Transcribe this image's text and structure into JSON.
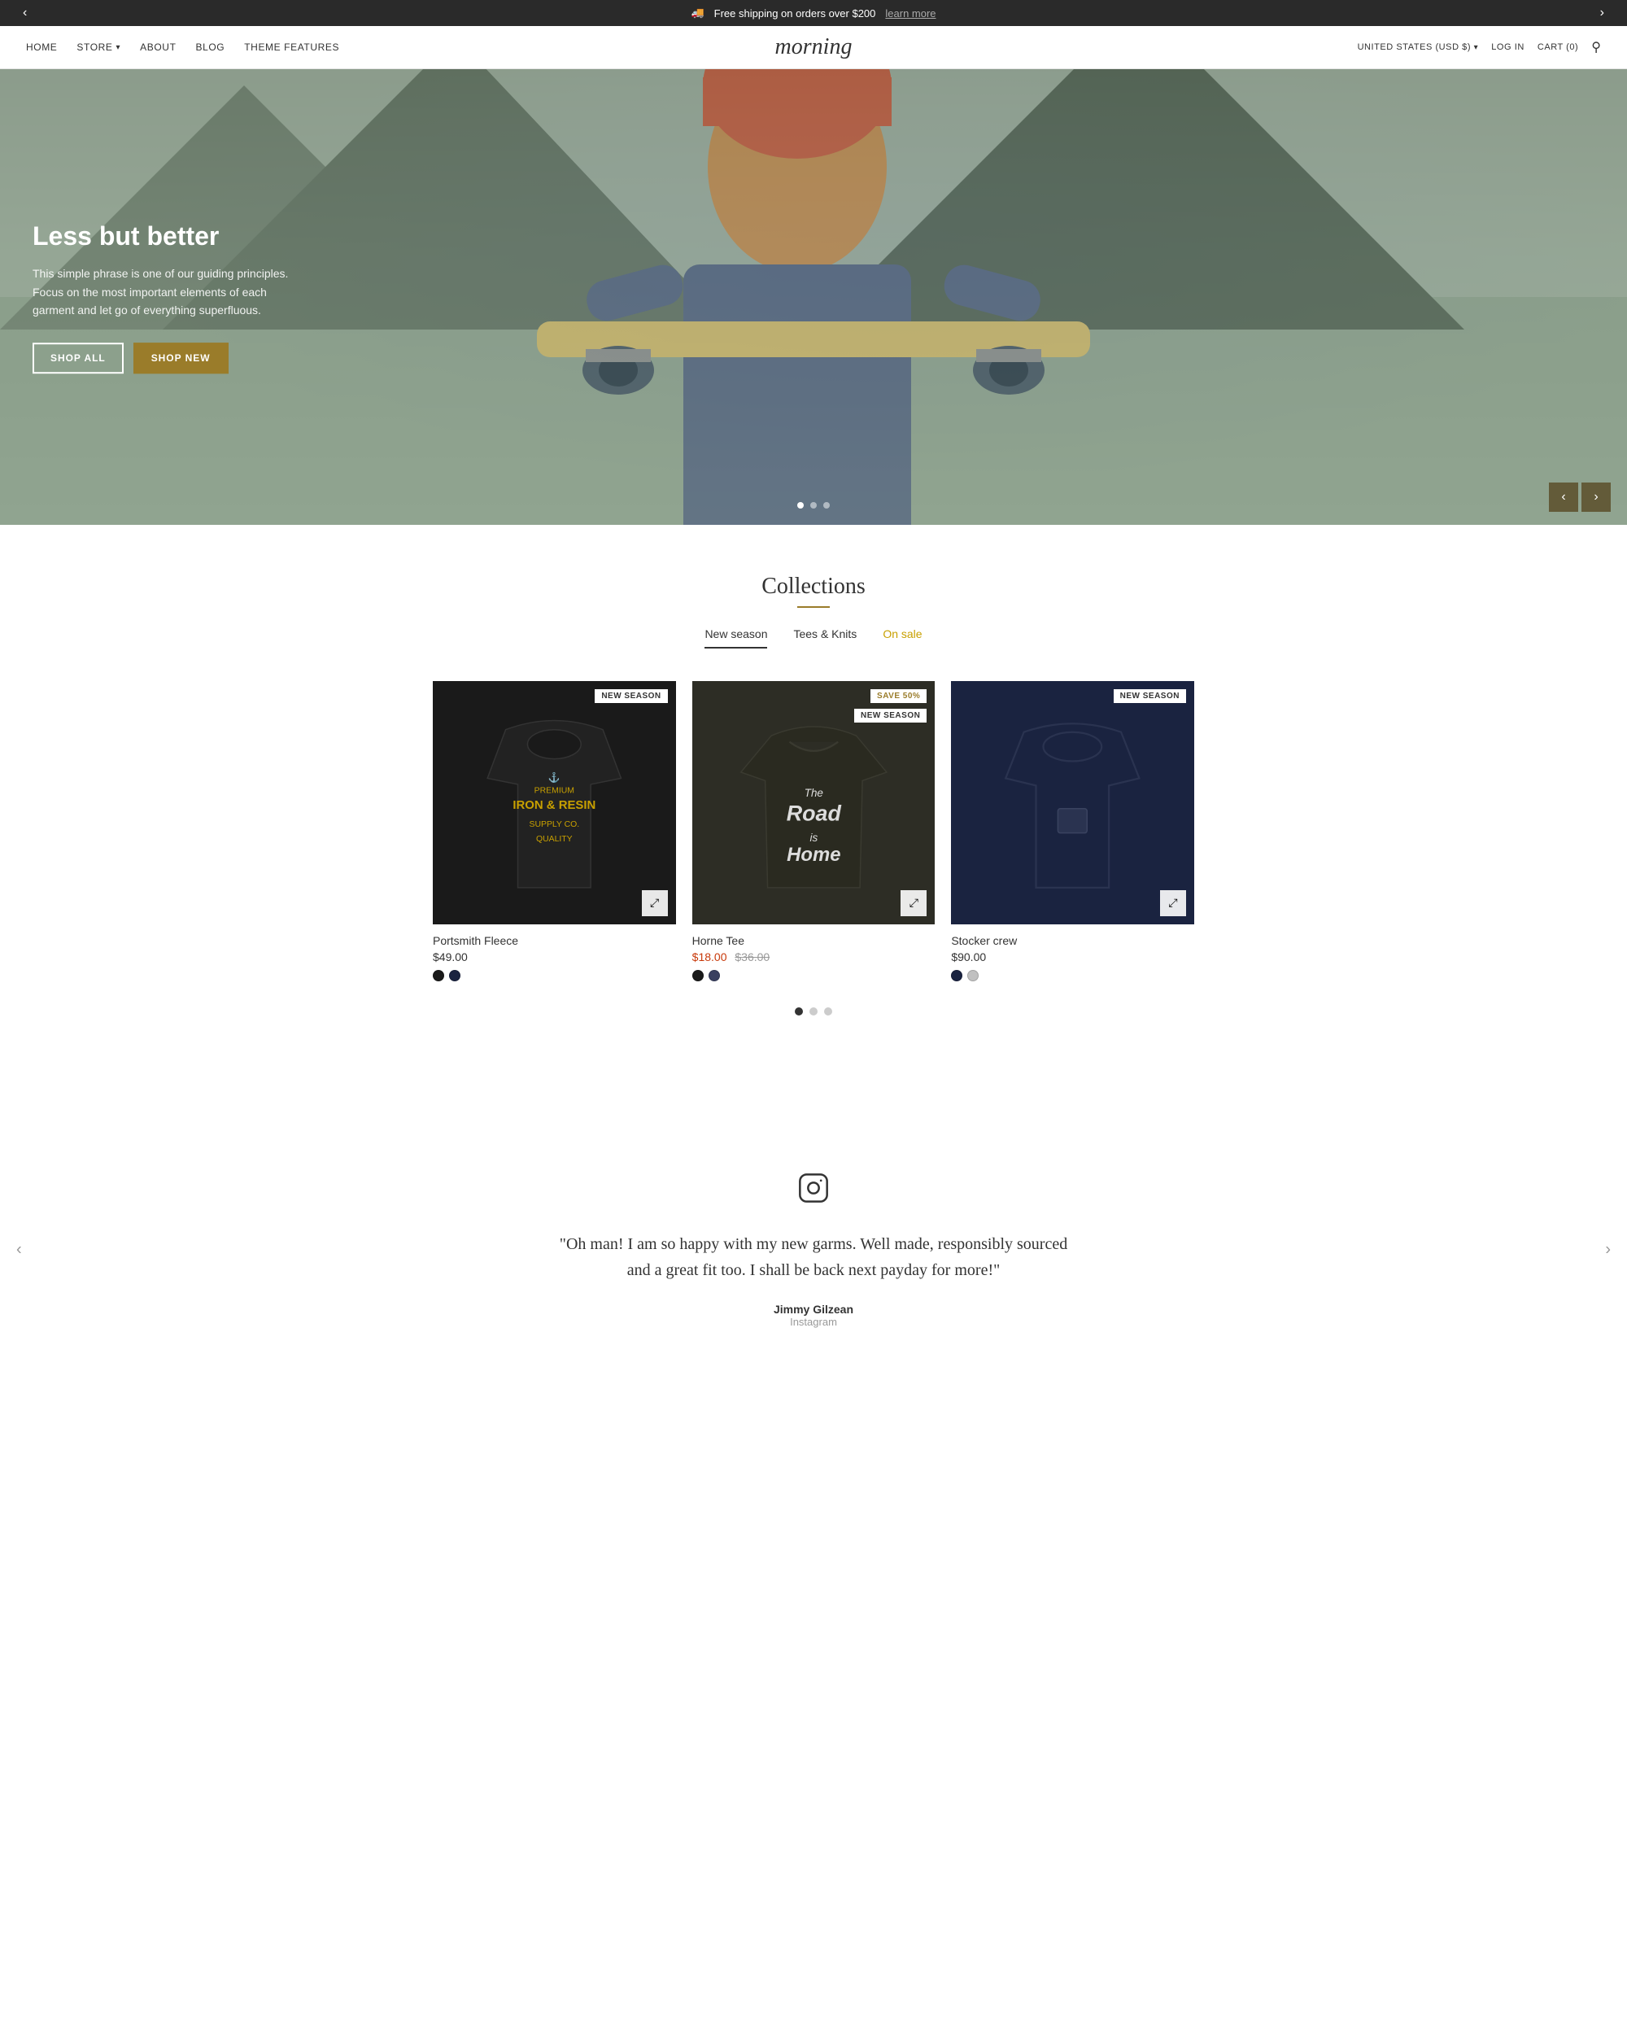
{
  "announcement": {
    "text": "Free shipping on orders over $200",
    "link_text": "learn more",
    "link_url": "#"
  },
  "nav": {
    "left_items": [
      {
        "id": "home",
        "label": "HOME",
        "url": "#"
      },
      {
        "id": "store",
        "label": "STORE",
        "url": "#",
        "has_dropdown": true
      },
      {
        "id": "about",
        "label": "ABOUT",
        "url": "#"
      },
      {
        "id": "blog",
        "label": "BLOG",
        "url": "#"
      },
      {
        "id": "theme-features",
        "label": "THEME FEATURES",
        "url": "#"
      }
    ],
    "logo": "morning",
    "right_items": [
      {
        "id": "region",
        "label": "UNITED STATES (USD $)",
        "url": "#",
        "has_dropdown": true
      },
      {
        "id": "login",
        "label": "LOG IN",
        "url": "#"
      },
      {
        "id": "cart",
        "label": "CART (0)",
        "url": "#"
      }
    ]
  },
  "hero": {
    "title": "Less but better",
    "description": "This simple phrase is one of our guiding principles. Focus on the most important elements of each garment and let go of everything superfluous.",
    "btn_shop_all": "SHOP ALL",
    "btn_shop_new": "SHOP NEW",
    "dots": [
      1,
      2,
      3
    ],
    "active_dot": 1
  },
  "collections": {
    "title": "Collections",
    "tabs": [
      {
        "id": "new-season",
        "label": "New season",
        "active": true,
        "sale": false
      },
      {
        "id": "tees-knits",
        "label": "Tees & Knits",
        "active": false,
        "sale": false
      },
      {
        "id": "on-sale",
        "label": "On sale",
        "active": false,
        "sale": true
      }
    ],
    "products": [
      {
        "id": "portsmith-fleece",
        "name": "Portsmith Fleece",
        "price": "$49.00",
        "sale_price": null,
        "original_price": null,
        "badge": "NEW SEASON",
        "badge2": null,
        "bg_color": "dark",
        "swatches": [
          "#1a1a1a",
          "#1a2340"
        ]
      },
      {
        "id": "horne-tee",
        "name": "Horne Tee",
        "price": null,
        "sale_price": "$18.00",
        "original_price": "$36.00",
        "badge": "SAVE 50%",
        "badge2": "NEW SEASON",
        "bg_color": "brown",
        "swatches": [
          "#1a1a1a",
          "#3a4060"
        ]
      },
      {
        "id": "stocker-crew",
        "name": "Stocker crew",
        "price": "$90.00",
        "sale_price": null,
        "original_price": null,
        "badge": "NEW SEASON",
        "badge2": null,
        "bg_color": "navy",
        "swatches": [
          "#1a2340",
          "#c0c0c0"
        ]
      }
    ],
    "pagination": [
      true,
      false,
      false
    ]
  },
  "testimonial": {
    "quote": "\"Oh man! I am so happy with my new garms. Well made, responsibly sourced and a great fit too. I shall be back next payday for more!\"",
    "author": "Jimmy Gilzean",
    "source": "Instagram"
  },
  "icons": {
    "prev_arrow": "‹",
    "next_arrow": "›",
    "search": "🔍",
    "share": "⤢",
    "instagram": "○"
  }
}
